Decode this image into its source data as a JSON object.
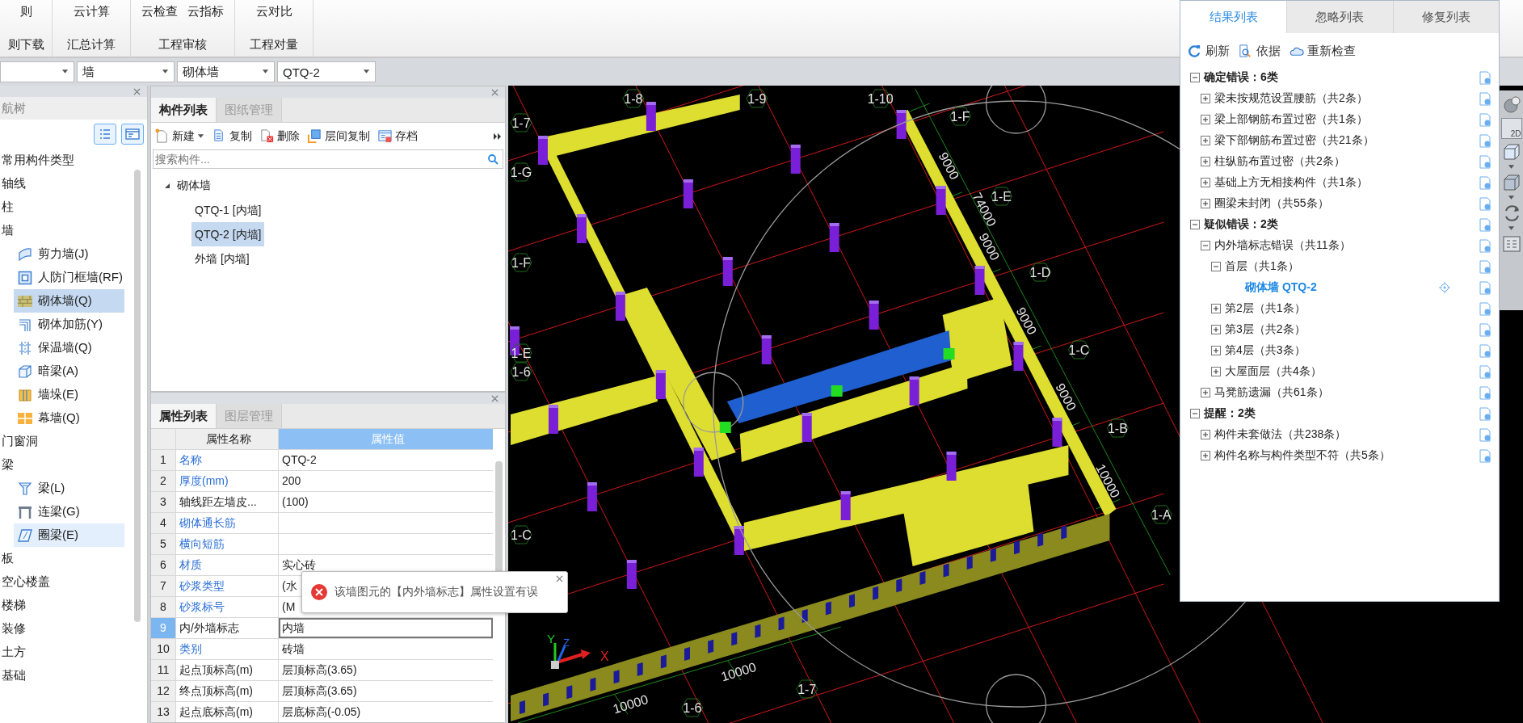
{
  "ribbon": {
    "groups": [
      {
        "buttons": [
          "则"
        ],
        "caption": "则下载"
      },
      {
        "buttons": [
          "云计算"
        ],
        "caption": "汇总计算"
      },
      {
        "buttons": [
          "云检查",
          "云指标"
        ],
        "caption": "工程审核"
      },
      {
        "buttons": [
          "云对比"
        ],
        "caption": "工程对量"
      }
    ]
  },
  "selectors": [
    "墙",
    "砌体墙",
    "QTQ-2"
  ],
  "nav_tree": {
    "title": "航树",
    "items": [
      {
        "label": "常用构件类型",
        "selected": false
      },
      {
        "label": "轴线",
        "selected": false
      },
      {
        "label": "柱",
        "selected": false
      },
      {
        "label": "墙",
        "selected": false,
        "children": [
          {
            "label": "剪力墙(J)",
            "selected": false
          },
          {
            "label": "人防门框墙(RF)",
            "selected": false
          },
          {
            "label": "砌体墙(Q)",
            "selected": true
          },
          {
            "label": "砌体加筋(Y)",
            "selected": false
          },
          {
            "label": "保温墙(Q)",
            "selected": false
          },
          {
            "label": "暗梁(A)",
            "selected": false
          },
          {
            "label": "墙垛(E)",
            "selected": false
          },
          {
            "label": "幕墙(Q)",
            "selected": false
          }
        ]
      },
      {
        "label": "门窗洞",
        "selected": false
      },
      {
        "label": "梁",
        "selected": false,
        "children": [
          {
            "label": "梁(L)",
            "selected": false,
            "hovered": false
          },
          {
            "label": "连梁(G)",
            "selected": false,
            "hovered": false
          },
          {
            "label": "圈梁(E)",
            "selected": false,
            "hovered": true
          }
        ]
      },
      {
        "label": "板",
        "selected": false
      },
      {
        "label": "空心楼盖",
        "selected": false
      },
      {
        "label": "楼梯",
        "selected": false
      },
      {
        "label": "装修",
        "selected": false
      },
      {
        "label": "土方",
        "selected": false
      },
      {
        "label": "基础",
        "selected": false
      }
    ]
  },
  "component_panel": {
    "tabs": [
      {
        "label": "构件列表",
        "selected": true
      },
      {
        "label": "图纸管理",
        "selected": false
      }
    ],
    "toolbar": [
      "新建",
      "复制",
      "删除",
      "层间复制",
      "存档"
    ],
    "search": {
      "placeholder": "搜索构件..."
    },
    "tree": {
      "label": "砌体墙",
      "expanded": true,
      "children": [
        {
          "label": "QTQ-1 [内墙]",
          "selected": false
        },
        {
          "label": "QTQ-2 [内墙]",
          "selected": true
        },
        {
          "label": "外墙 [内墙]",
          "selected": false
        }
      ]
    }
  },
  "property_panel": {
    "tabs": [
      {
        "label": "属性列表",
        "selected": true
      },
      {
        "label": "图层管理",
        "selected": false
      }
    ],
    "columns": [
      "属性名称",
      "属性值"
    ],
    "rows": [
      {
        "num": "1",
        "name": "名称",
        "value": "QTQ-2",
        "public": true,
        "selected": false
      },
      {
        "num": "2",
        "name": "厚度(mm)",
        "value": "200",
        "public": true,
        "selected": false
      },
      {
        "num": "3",
        "name": "轴线距左墙皮...",
        "value": "(100)",
        "public": false,
        "selected": false
      },
      {
        "num": "4",
        "name": "砌体通长筋",
        "public": true,
        "selected": false
      },
      {
        "num": "5",
        "name": "横向短筋",
        "public": true,
        "selected": false
      },
      {
        "num": "6",
        "name": "材质",
        "value": "实心砖",
        "public": true,
        "selected": false
      },
      {
        "num": "7",
        "name": "砂浆类型",
        "value": "(水",
        "public": true,
        "selected": false
      },
      {
        "num": "8",
        "name": "砂浆标号",
        "value": "(M",
        "public": true,
        "selected": false
      },
      {
        "num": "9",
        "name": "内/外墙标志",
        "value": "内墙",
        "public": false,
        "selected": true
      },
      {
        "num": "10",
        "name": "类别",
        "value": "砖墙",
        "public": true,
        "selected": false
      },
      {
        "num": "11",
        "name": "起点顶标高(m)",
        "value": "层顶标高(3.65)",
        "public": false,
        "selected": false
      },
      {
        "num": "12",
        "name": "终点顶标高(m)",
        "value": "层顶标高(3.65)",
        "public": false,
        "selected": false
      },
      {
        "num": "13",
        "name": "起点底标高(m)",
        "value": "层底标高(-0.05)",
        "public": false,
        "selected": false
      }
    ]
  },
  "error_tooltip": {
    "message": "该墙图元的【内外墙标志】属性设置有误"
  },
  "view_3d": {
    "axis_labels": [
      "1-8",
      "1-9",
      "1-7",
      "1-10",
      "1-F",
      "1-G",
      "1-E",
      "1-F",
      "1-D",
      "1-E",
      "1-6",
      "1-C",
      "1-B",
      "1-A",
      "1-C",
      "1-6",
      "1-7"
    ],
    "dimension_labels": [
      "9000",
      "74000",
      "9000",
      "9000",
      "9000",
      "10000",
      "10000",
      "10000"
    ],
    "axis_gizmo": [
      "X",
      "Y",
      "Z"
    ]
  },
  "view_toolbar": {
    "mode_label": "2D"
  },
  "check_panel": {
    "tabs": [
      {
        "label": "结果列表",
        "selected": true
      },
      {
        "label": "忽略列表",
        "selected": false
      },
      {
        "label": "修复列表",
        "selected": false
      }
    ],
    "toolbar": [
      "刷新",
      "依据",
      "重新检查"
    ],
    "tree": [
      {
        "label": "确定错误：6类",
        "expanded": true,
        "children": [
          {
            "label": "梁未按规范设置腰筋（共2条）",
            "expanded": false
          },
          {
            "label": "梁上部钢筋布置过密（共1条）",
            "expanded": false
          },
          {
            "label": "梁下部钢筋布置过密（共21条）",
            "expanded": false
          },
          {
            "label": "柱纵筋布置过密（共2条）",
            "expanded": false
          },
          {
            "label": "基础上方无相接构件（共1条）",
            "expanded": false
          },
          {
            "label": "圈梁未封闭（共55条）",
            "expanded": false
          }
        ]
      },
      {
        "label": "疑似错误：2类",
        "expanded": true,
        "children": [
          {
            "label": "内外墙标志错误（共11条）",
            "expanded": true,
            "children": [
              {
                "label": "首层（共1条）",
                "expanded": true,
                "children": [
                  {
                    "label": "砌体墙 QTQ-2",
                    "selected": true
                  }
                ]
              },
              {
                "label": "第2层（共1条）",
                "expanded": false
              },
              {
                "label": "第3层（共2条）",
                "expanded": false
              },
              {
                "label": "第4层（共3条）",
                "expanded": false
              },
              {
                "label": "大屋面层（共4条）",
                "expanded": false
              }
            ]
          },
          {
            "label": "马凳筋遗漏（共61条）",
            "expanded": false
          }
        ]
      },
      {
        "label": "提醒：2类",
        "expanded": true,
        "children": [
          {
            "label": "构件未套做法（共238条）",
            "expanded": false
          },
          {
            "label": "构件名称与构件类型不符（共5条）",
            "expanded": false
          }
        ]
      }
    ]
  }
}
